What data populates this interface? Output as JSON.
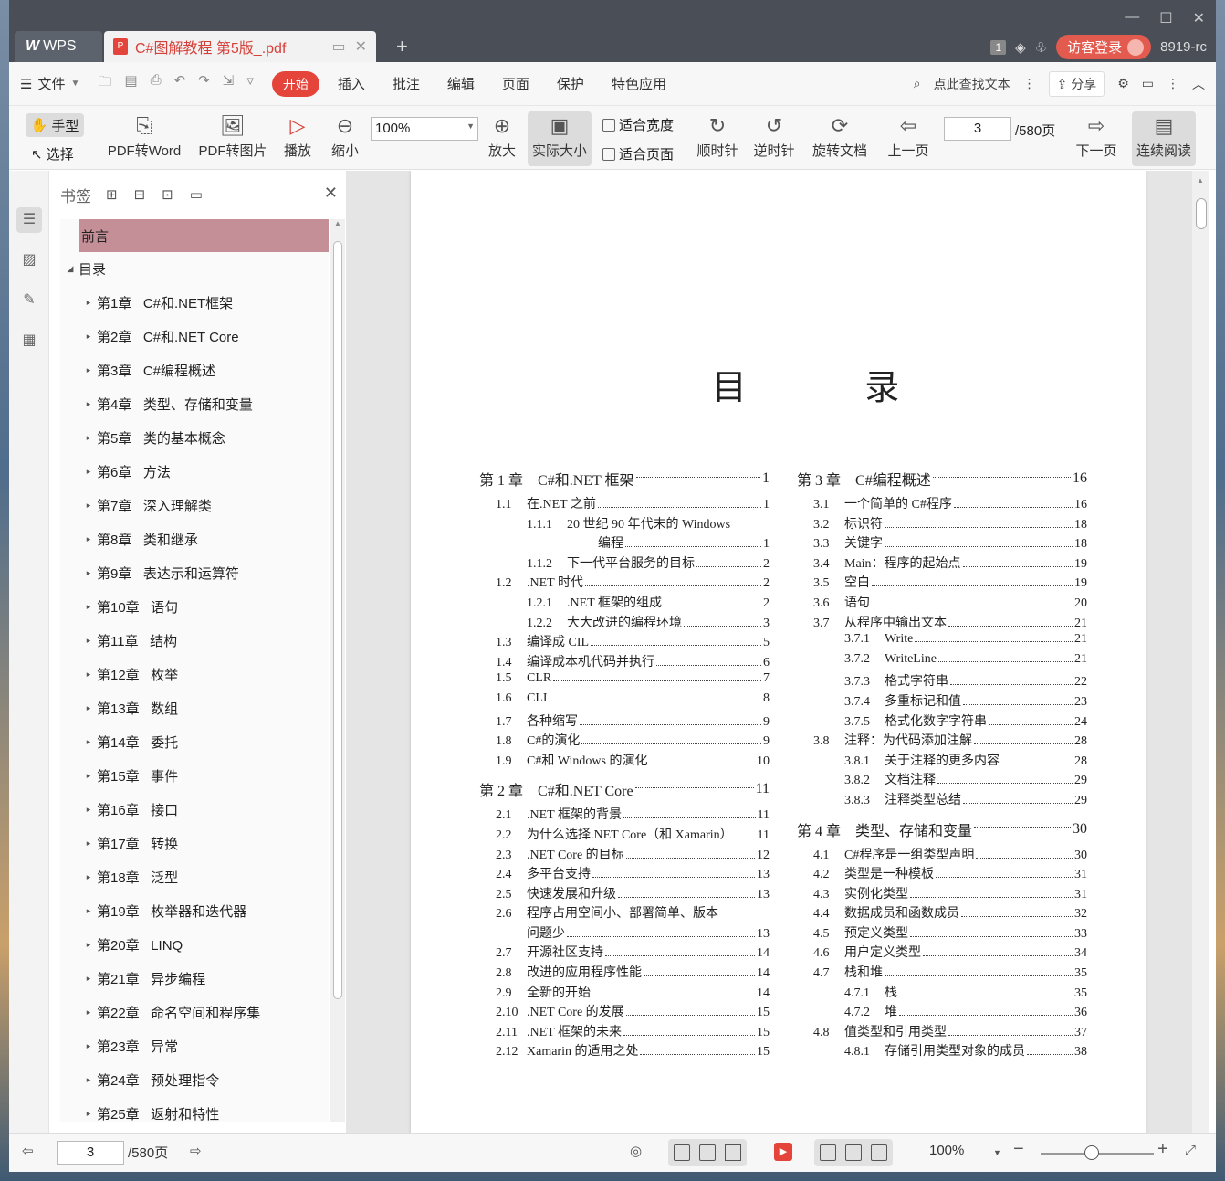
{
  "titlebar": {
    "wps_label": "WPS",
    "doc_tab": "C#图解教程 第5版_.pdf",
    "new_tab": "+",
    "badge": "1",
    "login": "访客登录",
    "user_id": "8919-rc"
  },
  "menubar": {
    "file": "文件",
    "tabs": [
      "开始",
      "插入",
      "批注",
      "编辑",
      "页面",
      "保护",
      "特色应用"
    ],
    "active_tab": "开始",
    "search": "点此查找文本",
    "share": "分享"
  },
  "toolbar": {
    "hand": "手型",
    "select": "选择",
    "pdf_to_word": "PDF转Word",
    "pdf_to_image": "PDF转图片",
    "play": "播放",
    "zoom_out": "缩小",
    "zoom_value": "100%",
    "zoom_in": "放大",
    "actual_size": "实际大小",
    "fit_width": "适合宽度",
    "fit_page": "适合页面",
    "clockwise": "顺时针",
    "counterclockwise": "逆时针",
    "rotate_doc": "旋转文档",
    "prev_page": "上一页",
    "page_value": "3",
    "page_total": "/580页",
    "next_page": "下一页",
    "continuous": "连续阅读"
  },
  "bookmarks": {
    "title": "书签",
    "items": [
      {
        "label": "前言",
        "level": 0,
        "selected": true
      },
      {
        "label": "目录",
        "level": 0,
        "expanded": true
      },
      {
        "label": "第1章   C#和.NET框架",
        "level": 1
      },
      {
        "label": "第2章   C#和.NET Core",
        "level": 1
      },
      {
        "label": "第3章   C#编程概述",
        "level": 1
      },
      {
        "label": "第4章   类型、存储和变量",
        "level": 1
      },
      {
        "label": "第5章   类的基本概念",
        "level": 1
      },
      {
        "label": "第6章   方法",
        "level": 1
      },
      {
        "label": "第7章   深入理解类",
        "level": 1
      },
      {
        "label": "第8章   类和继承",
        "level": 1
      },
      {
        "label": "第9章   表达示和运算符",
        "level": 1
      },
      {
        "label": "第10章   语句",
        "level": 1
      },
      {
        "label": "第11章   结构",
        "level": 1
      },
      {
        "label": "第12章   枚举",
        "level": 1
      },
      {
        "label": "第13章   数组",
        "level": 1
      },
      {
        "label": "第14章   委托",
        "level": 1
      },
      {
        "label": "第15章   事件",
        "level": 1
      },
      {
        "label": "第16章   接口",
        "level": 1
      },
      {
        "label": "第17章   转换",
        "level": 1
      },
      {
        "label": "第18章   泛型",
        "level": 1
      },
      {
        "label": "第19章   枚举器和迭代器",
        "level": 1
      },
      {
        "label": "第20章   LINQ",
        "level": 1
      },
      {
        "label": "第21章   异步编程",
        "level": 1
      },
      {
        "label": "第22章   命名空间和程序集",
        "level": 1
      },
      {
        "label": "第23章   异常",
        "level": 1
      },
      {
        "label": "第24章   预处理指令",
        "level": 1
      },
      {
        "label": "第25章   返射和特性",
        "level": 1
      }
    ]
  },
  "document": {
    "title": "目  录",
    "left_column": [
      {
        "type": "ch",
        "num": "第 1 章",
        "title": "C#和.NET 框架",
        "page": "1"
      },
      {
        "type": "l1",
        "num": "1.1",
        "title": "在.NET 之前",
        "page": "1"
      },
      {
        "type": "l2",
        "num": "1.1.1",
        "title": "20 世纪 90 年代末的 Windows",
        "page": ""
      },
      {
        "type": "cont",
        "num": "",
        "title": "编程",
        "page": "1"
      },
      {
        "type": "l2",
        "num": "1.1.2",
        "title": "下一代平台服务的目标",
        "page": "2"
      },
      {
        "type": "l1",
        "num": "1.2",
        "title": ".NET 时代",
        "page": "2"
      },
      {
        "type": "l2",
        "num": "1.2.1",
        "title": ".NET 框架的组成",
        "page": "2"
      },
      {
        "type": "l2",
        "num": "1.2.2",
        "title": "大大改进的编程环境",
        "page": "3"
      },
      {
        "type": "l1",
        "num": "1.3",
        "title": "编译成 CIL",
        "page": "5"
      },
      {
        "type": "l1",
        "num": "1.4",
        "title": "编译成本机代码并执行",
        "page": "6"
      },
      {
        "type": "l1",
        "num": "1.5",
        "title": "CLR",
        "page": "7"
      },
      {
        "type": "l1",
        "num": "1.6",
        "title": "CLI",
        "page": "8"
      },
      {
        "type": "l1",
        "num": "1.7",
        "title": "各种缩写",
        "page": "9"
      },
      {
        "type": "l1",
        "num": "1.8",
        "title": "C#的演化",
        "page": "9"
      },
      {
        "type": "l1",
        "num": "1.9",
        "title": "C#和 Windows 的演化",
        "page": "10"
      },
      {
        "type": "ch",
        "num": "第 2 章",
        "title": "C#和.NET Core",
        "page": "11"
      },
      {
        "type": "l1",
        "num": "2.1",
        "title": ".NET 框架的背景",
        "page": "11"
      },
      {
        "type": "l1",
        "num": "2.2",
        "title": "为什么选择.NET Core（和 Xamarin）",
        "page": "11"
      },
      {
        "type": "l1",
        "num": "2.3",
        "title": ".NET Core 的目标",
        "page": "12"
      },
      {
        "type": "l1",
        "num": "2.4",
        "title": "多平台支持",
        "page": "13"
      },
      {
        "type": "l1",
        "num": "2.5",
        "title": "快速发展和升级",
        "page": "13"
      },
      {
        "type": "l1",
        "num": "2.6",
        "title": "程序占用空间小、部署简单、版本",
        "page": ""
      },
      {
        "type": "l1c",
        "num": "",
        "title": "问题少",
        "page": "13"
      },
      {
        "type": "l1",
        "num": "2.7",
        "title": "开源社区支持",
        "page": "14"
      },
      {
        "type": "l1",
        "num": "2.8",
        "title": "改进的应用程序性能",
        "page": "14"
      },
      {
        "type": "l1",
        "num": "2.9",
        "title": "全新的开始",
        "page": "14"
      },
      {
        "type": "l1",
        "num": "2.10",
        "title": ".NET Core 的发展",
        "page": "15"
      },
      {
        "type": "l1",
        "num": "2.11",
        "title": ".NET 框架的未来",
        "page": "15"
      },
      {
        "type": "l1",
        "num": "2.12",
        "title": "Xamarin 的适用之处",
        "page": "15"
      }
    ],
    "right_column": [
      {
        "type": "ch",
        "num": "第 3 章",
        "title": "C#编程概述",
        "page": "16"
      },
      {
        "type": "l1",
        "num": "3.1",
        "title": "一个简单的 C#程序",
        "page": "16"
      },
      {
        "type": "l1",
        "num": "3.2",
        "title": "标识符",
        "page": "18"
      },
      {
        "type": "l1",
        "num": "3.3",
        "title": "关键字",
        "page": "18"
      },
      {
        "type": "l1",
        "num": "3.4",
        "title": "Main：程序的起始点",
        "page": "19"
      },
      {
        "type": "l1",
        "num": "3.5",
        "title": "空白",
        "page": "19"
      },
      {
        "type": "l1",
        "num": "3.6",
        "title": "语句",
        "page": "20"
      },
      {
        "type": "l1",
        "num": "3.7",
        "title": "从程序中输出文本",
        "page": "21"
      },
      {
        "type": "l2",
        "num": "3.7.1",
        "title": "Write",
        "page": "21"
      },
      {
        "type": "l2",
        "num": "3.7.2",
        "title": "WriteLine",
        "page": "21"
      },
      {
        "type": "l2",
        "num": "3.7.3",
        "title": "格式字符串",
        "page": "22"
      },
      {
        "type": "l2",
        "num": "3.7.4",
        "title": "多重标记和值",
        "page": "23"
      },
      {
        "type": "l2",
        "num": "3.7.5",
        "title": "格式化数字字符串",
        "page": "24"
      },
      {
        "type": "l1",
        "num": "3.8",
        "title": "注释：为代码添加注解",
        "page": "28"
      },
      {
        "type": "l2",
        "num": "3.8.1",
        "title": "关于注释的更多内容",
        "page": "28"
      },
      {
        "type": "l2",
        "num": "3.8.2",
        "title": "文档注释",
        "page": "29"
      },
      {
        "type": "l2",
        "num": "3.8.3",
        "title": "注释类型总结",
        "page": "29"
      },
      {
        "type": "ch",
        "num": "第 4 章",
        "title": "类型、存储和变量",
        "page": "30"
      },
      {
        "type": "l1",
        "num": "4.1",
        "title": "C#程序是一组类型声明",
        "page": "30"
      },
      {
        "type": "l1",
        "num": "4.2",
        "title": "类型是一种模板",
        "page": "31"
      },
      {
        "type": "l1",
        "num": "4.3",
        "title": "实例化类型",
        "page": "31"
      },
      {
        "type": "l1",
        "num": "4.4",
        "title": "数据成员和函数成员",
        "page": "32"
      },
      {
        "type": "l1",
        "num": "4.5",
        "title": "预定义类型",
        "page": "33"
      },
      {
        "type": "l1",
        "num": "4.6",
        "title": "用户定义类型",
        "page": "34"
      },
      {
        "type": "l1",
        "num": "4.7",
        "title": "栈和堆",
        "page": "35"
      },
      {
        "type": "l2",
        "num": "4.7.1",
        "title": "栈",
        "page": "35"
      },
      {
        "type": "l2",
        "num": "4.7.2",
        "title": "堆",
        "page": "36"
      },
      {
        "type": "l1",
        "num": "4.8",
        "title": "值类型和引用类型",
        "page": "37"
      },
      {
        "type": "l2",
        "num": "4.8.1",
        "title": "存储引用类型对象的成员",
        "page": "38"
      }
    ]
  },
  "statusbar": {
    "page_value": "3",
    "page_total": "/580页",
    "zoom": "100%",
    "zoom_level_percent": 100
  }
}
